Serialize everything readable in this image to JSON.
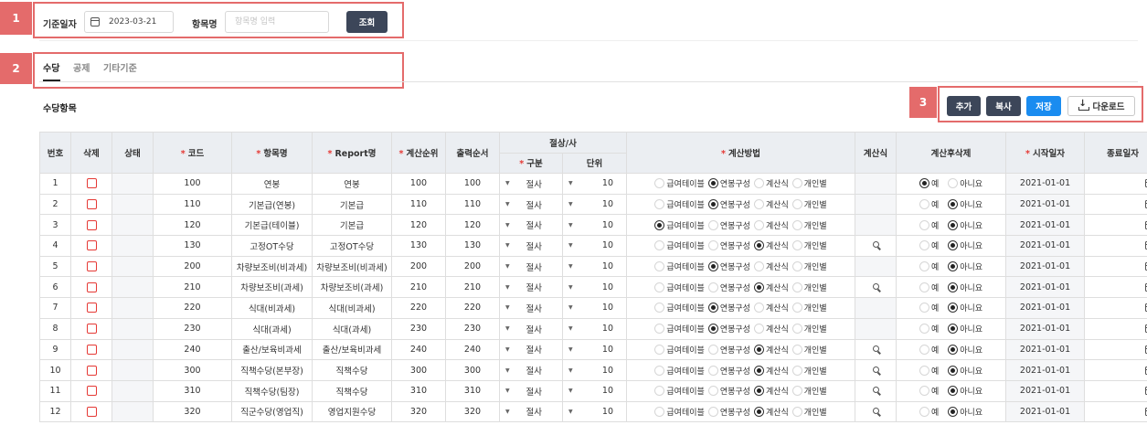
{
  "badges": [
    "1",
    "2",
    "3"
  ],
  "search": {
    "date_label": "기준일자",
    "date_value": "2023-03-21",
    "name_label": "항목명",
    "name_placeholder": "항목명 입력",
    "search_button": "조회"
  },
  "tabs": [
    {
      "label": "수당",
      "active": true
    },
    {
      "label": "공제",
      "active": false
    },
    {
      "label": "기타기준",
      "active": false
    }
  ],
  "section_title": "수당항목",
  "toolbar": {
    "add": "추가",
    "copy": "복사",
    "save": "저장",
    "download": "다운로드"
  },
  "table": {
    "headers": {
      "no": "번호",
      "delete": "삭제",
      "status": "상태",
      "code": "코드",
      "name": "항목명",
      "report": "Report명",
      "calc_order": "계산순위",
      "print_order": "출력순서",
      "rounding": "절상/사",
      "rounding_type": "구분",
      "rounding_unit": "단위",
      "method": "계산방법",
      "formula": "계산식",
      "delete_after": "계산후삭제",
      "start": "시작일자",
      "end": "종료일자"
    },
    "required_mark": "*",
    "method_options": [
      "급여테이블",
      "연봉구성",
      "계산식",
      "개인별"
    ],
    "yn_options": [
      "예",
      "아니요"
    ],
    "rows": [
      {
        "no": "1",
        "code": "100",
        "name": "연봉",
        "report": "연봉",
        "calc": "100",
        "print": "100",
        "rtype": "절사",
        "unit": "10",
        "method": 1,
        "formula": false,
        "del": 0,
        "start": "2021-01-01"
      },
      {
        "no": "2",
        "code": "110",
        "name": "기본급(연봉)",
        "report": "기본급",
        "calc": "110",
        "print": "110",
        "rtype": "절사",
        "unit": "10",
        "method": 1,
        "formula": false,
        "del": 1,
        "start": "2021-01-01"
      },
      {
        "no": "3",
        "code": "120",
        "name": "기본급(테이블)",
        "report": "기본급",
        "calc": "120",
        "print": "120",
        "rtype": "절사",
        "unit": "10",
        "method": 0,
        "formula": false,
        "del": 1,
        "start": "2021-01-01"
      },
      {
        "no": "4",
        "code": "130",
        "name": "고정OT수당",
        "report": "고정OT수당",
        "calc": "130",
        "print": "130",
        "rtype": "절사",
        "unit": "10",
        "method": 2,
        "formula": true,
        "del": 1,
        "start": "2021-01-01"
      },
      {
        "no": "5",
        "code": "200",
        "name": "차량보조비(비과세)",
        "report": "차량보조비(비과세)",
        "calc": "200",
        "print": "200",
        "rtype": "절사",
        "unit": "10",
        "method": 1,
        "formula": false,
        "del": 1,
        "start": "2021-01-01"
      },
      {
        "no": "6",
        "code": "210",
        "name": "차량보조비(과세)",
        "report": "차량보조비(과세)",
        "calc": "210",
        "print": "210",
        "rtype": "절사",
        "unit": "10",
        "method": 2,
        "formula": true,
        "del": 1,
        "start": "2021-01-01"
      },
      {
        "no": "7",
        "code": "220",
        "name": "식대(비과세)",
        "report": "식대(비과세)",
        "calc": "220",
        "print": "220",
        "rtype": "절사",
        "unit": "10",
        "method": 1,
        "formula": false,
        "del": 1,
        "start": "2021-01-01"
      },
      {
        "no": "8",
        "code": "230",
        "name": "식대(과세)",
        "report": "식대(과세)",
        "calc": "230",
        "print": "230",
        "rtype": "절사",
        "unit": "10",
        "method": 1,
        "formula": false,
        "del": 1,
        "start": "2021-01-01"
      },
      {
        "no": "9",
        "code": "240",
        "name": "출산/보육비과세",
        "report": "출산/보육비과세",
        "calc": "240",
        "print": "240",
        "rtype": "절사",
        "unit": "10",
        "method": 2,
        "formula": true,
        "del": 1,
        "start": "2021-01-01"
      },
      {
        "no": "10",
        "code": "300",
        "name": "직책수당(본부장)",
        "report": "직책수당",
        "calc": "300",
        "print": "300",
        "rtype": "절사",
        "unit": "10",
        "method": 2,
        "formula": true,
        "del": 1,
        "start": "2021-01-01"
      },
      {
        "no": "11",
        "code": "310",
        "name": "직책수당(팀장)",
        "report": "직책수당",
        "calc": "310",
        "print": "310",
        "rtype": "절사",
        "unit": "10",
        "method": 2,
        "formula": true,
        "del": 1,
        "start": "2021-01-01"
      },
      {
        "no": "12",
        "code": "320",
        "name": "직군수당(영업직)",
        "report": "영업지원수당",
        "calc": "320",
        "print": "320",
        "rtype": "절사",
        "unit": "10",
        "method": 2,
        "formula": true,
        "del": 1,
        "start": "2021-01-01"
      }
    ]
  }
}
